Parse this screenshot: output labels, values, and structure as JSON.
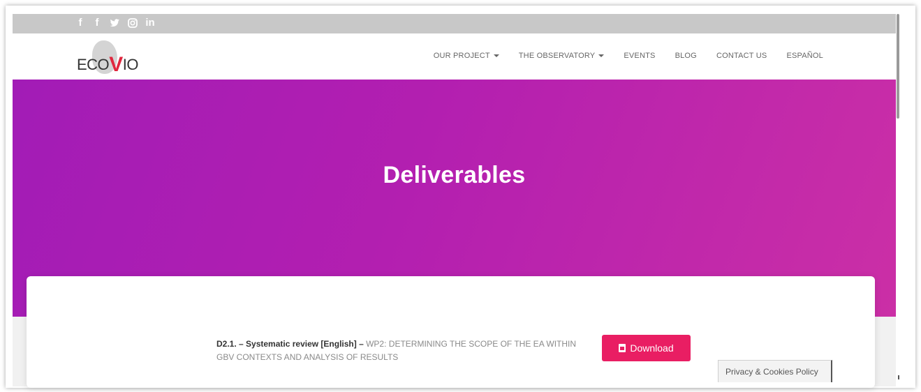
{
  "social": {
    "icons": [
      "facebook-icon",
      "facebook-icon",
      "twitter-icon",
      "instagram-icon",
      "linkedin-icon"
    ],
    "glyphs": [
      "f",
      "f",
      "",
      "",
      "in"
    ]
  },
  "logo": {
    "prefix": "ECO",
    "v": "V",
    "suffix": "IO"
  },
  "nav": {
    "items": [
      {
        "label": "OUR PROJECT",
        "dropdown": true
      },
      {
        "label": "THE OBSERVATORY",
        "dropdown": true
      },
      {
        "label": "EVENTS",
        "dropdown": false
      },
      {
        "label": "BLOG",
        "dropdown": false
      },
      {
        "label": "CONTACT US",
        "dropdown": false
      },
      {
        "label": "ESPAÑOL",
        "dropdown": false
      }
    ]
  },
  "hero": {
    "title": "Deliverables"
  },
  "deliverable": {
    "bold": "D2.1. – Systematic review [English] –",
    "desc": " WP2: DETERMINING THE SCOPE OF THE EA WITHIN GBV CONTEXTS AND ANALYSIS OF RESULTS",
    "button": "Download"
  },
  "cookie": {
    "label": "Privacy & Cookies Policy"
  },
  "colors": {
    "accent": "#e91e63",
    "hero_start": "#a21cb6",
    "hero_end": "#cb2fa6",
    "logo_v": "#e0263d"
  }
}
